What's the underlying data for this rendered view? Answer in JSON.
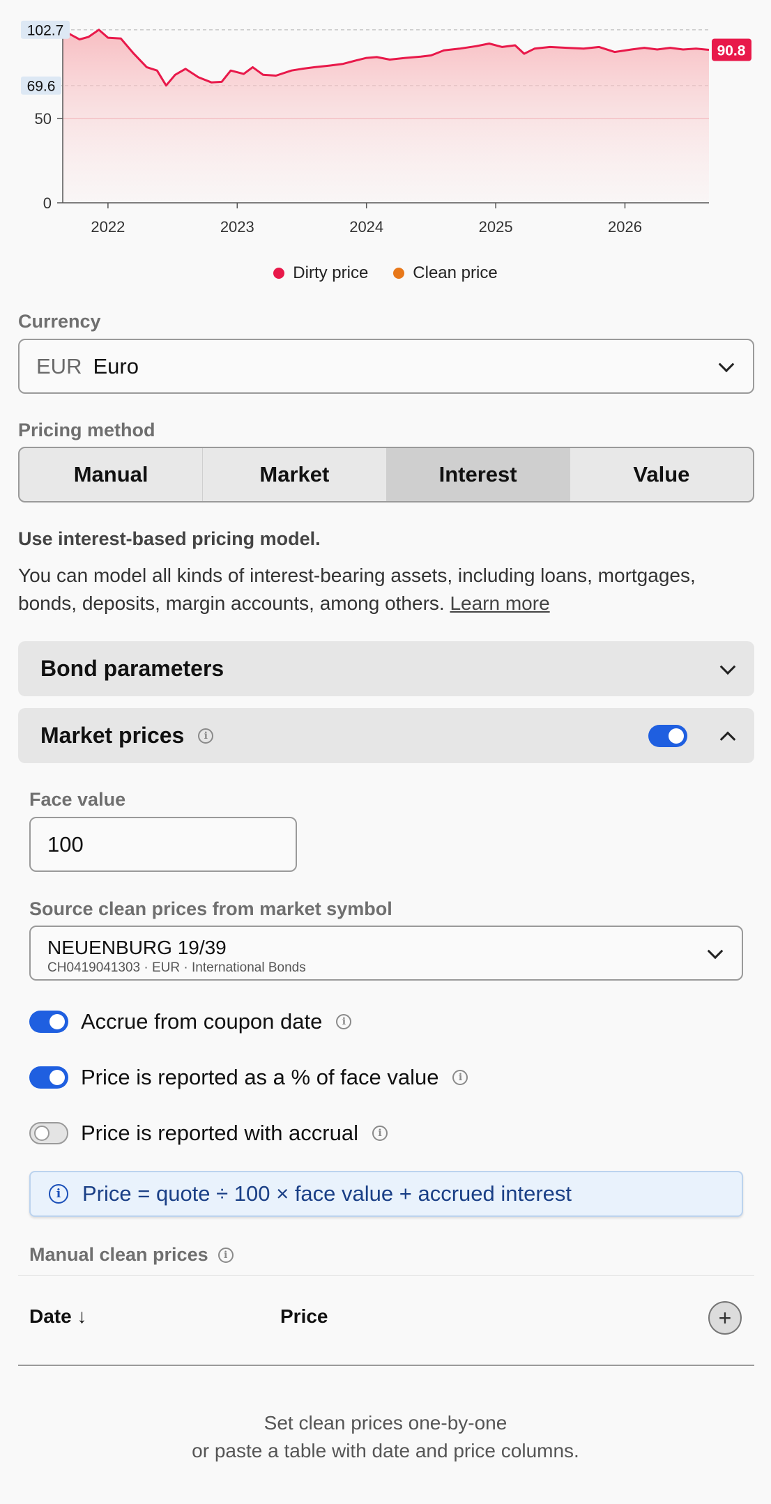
{
  "chart_data": {
    "type": "area",
    "x_unit": "year",
    "x_ticks": [
      "2022",
      "2023",
      "2024",
      "2025",
      "2026"
    ],
    "y_ticks": [
      "0",
      "50"
    ],
    "ylim": [
      0,
      103
    ],
    "xlim": [
      2021.65,
      2026.65
    ],
    "grid": "horizontal reference lines",
    "reference_lines": [
      {
        "label": "102.7",
        "value": 102.7,
        "style": "dashed"
      },
      {
        "label": "69.6",
        "value": 69.6,
        "style": "dashed"
      }
    ],
    "end_label": "90.8",
    "series": [
      {
        "name": "Dirty price",
        "color": "#e8194a",
        "points": [
          [
            2021.65,
            102.5
          ],
          [
            2021.72,
            99.5
          ],
          [
            2021.78,
            97.0
          ],
          [
            2021.85,
            98.5
          ],
          [
            2021.93,
            102.7
          ],
          [
            2022.0,
            98.0
          ],
          [
            2022.1,
            97.5
          ],
          [
            2022.2,
            88.5
          ],
          [
            2022.3,
            80.5
          ],
          [
            2022.38,
            78.5
          ],
          [
            2022.45,
            69.6
          ],
          [
            2022.52,
            76.0
          ],
          [
            2022.6,
            79.5
          ],
          [
            2022.7,
            74.5
          ],
          [
            2022.8,
            71.5
          ],
          [
            2022.88,
            71.8
          ],
          [
            2022.95,
            78.5
          ],
          [
            2023.05,
            76.5
          ],
          [
            2023.12,
            80.5
          ],
          [
            2023.2,
            76.0
          ],
          [
            2023.3,
            75.5
          ],
          [
            2023.42,
            78.5
          ],
          [
            2023.5,
            79.5
          ],
          [
            2023.6,
            80.5
          ],
          [
            2023.72,
            81.5
          ],
          [
            2023.82,
            82.5
          ],
          [
            2023.92,
            84.5
          ],
          [
            2024.0,
            86.0
          ],
          [
            2024.08,
            86.5
          ],
          [
            2024.18,
            85.0
          ],
          [
            2024.3,
            86.0
          ],
          [
            2024.42,
            86.8
          ],
          [
            2024.5,
            87.5
          ],
          [
            2024.6,
            90.5
          ],
          [
            2024.72,
            91.5
          ],
          [
            2024.85,
            93.0
          ],
          [
            2024.95,
            94.5
          ],
          [
            2025.05,
            92.5
          ],
          [
            2025.15,
            93.5
          ],
          [
            2025.22,
            88.5
          ],
          [
            2025.3,
            91.5
          ],
          [
            2025.42,
            92.5
          ],
          [
            2025.55,
            92.0
          ],
          [
            2025.68,
            91.5
          ],
          [
            2025.8,
            92.5
          ],
          [
            2025.92,
            89.5
          ],
          [
            2026.05,
            91.0
          ],
          [
            2026.15,
            92.0
          ],
          [
            2026.25,
            91.0
          ],
          [
            2026.35,
            92.0
          ],
          [
            2026.45,
            91.0
          ],
          [
            2026.55,
            91.5
          ],
          [
            2026.65,
            90.8
          ]
        ]
      },
      {
        "name": "Clean price",
        "color": "#e8781a",
        "points": []
      }
    ]
  },
  "legend": [
    {
      "label": "Dirty price",
      "color": "#e8194a"
    },
    {
      "label": "Clean price",
      "color": "#e8781a"
    }
  ],
  "currency": {
    "label": "Currency",
    "code": "EUR",
    "name": "Euro"
  },
  "pricing_method": {
    "label": "Pricing method",
    "options": [
      "Manual",
      "Market",
      "Interest",
      "Value"
    ],
    "selected": "Interest",
    "title": "Use interest-based pricing model.",
    "description": "You can model all kinds of interest-bearing assets, including loans, mortgages, bonds, deposits, margin accounts, among others.",
    "learn_more": "Learn more"
  },
  "bond_parameters": {
    "title": "Bond parameters"
  },
  "market_prices": {
    "title": "Market prices",
    "enabled": true,
    "face_value_label": "Face value",
    "face_value": "100",
    "source_label": "Source clean prices from market symbol",
    "symbol_name": "NEUENBURG 19/39",
    "symbol_meta": "CH0419041303 · EUR · International Bonds",
    "switches": [
      {
        "label": "Accrue from coupon date",
        "on": true
      },
      {
        "label": "Price is reported as a % of face value",
        "on": true
      },
      {
        "label": "Price is reported with accrual",
        "on": false
      }
    ],
    "formula": "Price = quote ÷ 100 × face value + accrued interest"
  },
  "manual_prices": {
    "label": "Manual clean prices",
    "col_date": "Date",
    "col_price": "Price",
    "empty_line1": "Set clean prices one-by-one",
    "empty_line2": "or paste a table with date and price columns."
  }
}
